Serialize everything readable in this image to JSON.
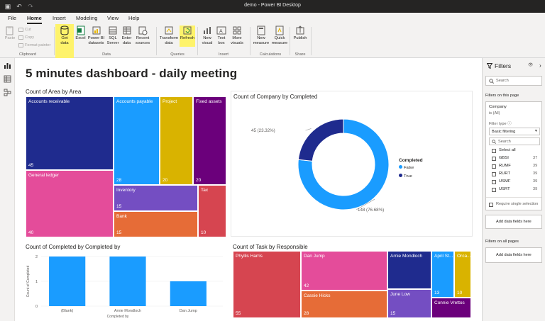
{
  "window": {
    "title": "demo - Power BI Desktop"
  },
  "menu": {
    "tabs": [
      "File",
      "Home",
      "Insert",
      "Modeling",
      "View",
      "Help"
    ],
    "active": "Home"
  },
  "ribbon": {
    "paste": "Paste",
    "cut": "Cut",
    "copy": "Copy",
    "format_painter": "Format painter",
    "get_data": [
      "Get",
      "data"
    ],
    "excel": "Excel",
    "power_bi_datasets": [
      "Power BI",
      "datasets"
    ],
    "sql_server": [
      "SQL",
      "Server"
    ],
    "enter_data": [
      "Enter",
      "data"
    ],
    "recent_sources": [
      "Recent",
      "sources"
    ],
    "transform_data": [
      "Transform",
      "data"
    ],
    "refresh": "Refresh",
    "new_visual": [
      "New",
      "visual"
    ],
    "text_box": [
      "Text",
      "box"
    ],
    "more_visuals": [
      "More",
      "visuals"
    ],
    "new_measure": [
      "New",
      "measure"
    ],
    "quick_measure": [
      "Quick",
      "measure"
    ],
    "publish": "Publish",
    "groups": {
      "clipboard": "Clipboard",
      "data": "Data",
      "queries": "Queries",
      "insert": "Insert",
      "calculations": "Calculations",
      "share": "Share"
    }
  },
  "page": {
    "title": "5 minutes dashboard - daily meeting"
  },
  "visuals": {
    "area_treemap": {
      "title": "Count of Area by Area",
      "tiles": [
        {
          "label": "Accounts receivable",
          "value": "45",
          "color": "#1f2b8e"
        },
        {
          "label": "General ledger",
          "value": "40",
          "color": "#e44c9a"
        },
        {
          "label": "Accounts payable",
          "value": "28",
          "color": "#1a9cff"
        },
        {
          "label": "Project",
          "value": "20",
          "color": "#d9b300"
        },
        {
          "label": "Fixed assets",
          "value": "20",
          "color": "#6b007b"
        },
        {
          "label": "Inventory",
          "value": "15",
          "color": "#744ec2"
        },
        {
          "label": "Tax",
          "value": "10",
          "color": "#d64550"
        },
        {
          "label": "Bank",
          "value": "15",
          "color": "#e66c37"
        }
      ]
    },
    "company_donut": {
      "title": "Count of Company by Completed",
      "legend_title": "Completed",
      "slices": [
        {
          "name": "False",
          "value": 148,
          "label": "148 (76.68%)",
          "color": "#1a9cff"
        },
        {
          "name": "True",
          "value": 45,
          "label": "45 (23.32%)",
          "color": "#1f2b8e"
        }
      ]
    },
    "completed_bar": {
      "title": "Count of Completed by Completed by",
      "xlabel": "Completed by",
      "ylabel": "Count of Completed",
      "y_ticks": [
        "2",
        "1",
        "0"
      ]
    },
    "task_treemap": {
      "title": "Count of Task by Responsible",
      "tiles": [
        {
          "label": "Phyllis Harris",
          "value": "55",
          "color": "#d64550"
        },
        {
          "label": "Dan Jump",
          "value": "42",
          "color": "#e44c9a"
        },
        {
          "label": "Cassie Hicks",
          "value": "28",
          "color": "#e66c37"
        },
        {
          "label": "Arnie Mondloch",
          "value": "",
          "color": "#1f2b8e"
        },
        {
          "label": "June Low",
          "value": "15",
          "color": "#744ec2"
        },
        {
          "label": "April St...",
          "value": "13",
          "color": "#1a9cff"
        },
        {
          "label": "Orca...",
          "value": "10",
          "color": "#d9b300"
        },
        {
          "label": "Connie Vrettos",
          "value": "",
          "color": "#6b007b"
        }
      ]
    }
  },
  "chart_data": {
    "type": "bar",
    "title": "Count of Completed by Completed by",
    "categories": [
      "(Blank)",
      "Arnie Mondloch",
      "Dan Jump"
    ],
    "values": [
      2,
      2,
      1
    ],
    "xlabel": "Completed by",
    "ylabel": "Count of Completed",
    "ylim": [
      0,
      2
    ],
    "color": "#1a9cff"
  },
  "filters": {
    "title": "Filters",
    "search_placeholder": "Search",
    "on_this_page": "Filters on this page",
    "field": "Company",
    "condition": "is (All)",
    "filter_type_label": "Filter type",
    "filter_type_value": "Basic filtering",
    "inner_search": "Search",
    "select_all": "Select all",
    "items": [
      {
        "name": "GBSI",
        "count": "37"
      },
      {
        "name": "RUMF",
        "count": "39"
      },
      {
        "name": "RURT",
        "count": "39"
      },
      {
        "name": "USMF",
        "count": "39"
      },
      {
        "name": "USRT",
        "count": "39"
      }
    ],
    "require_single": "Require single selection",
    "add_fields": "Add data fields here",
    "on_all_pages": "Filters on all pages",
    "add_fields_all": "Add data fields here"
  }
}
